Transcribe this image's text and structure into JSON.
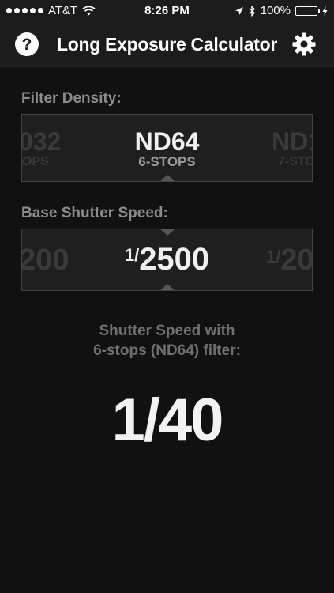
{
  "status_bar": {
    "carrier": "AT&T",
    "time": "8:26 PM",
    "battery": "100%"
  },
  "header": {
    "title": "Long Exposure Calculator",
    "help_icon": "question-circle-icon",
    "settings_icon": "gear-icon"
  },
  "filter_density": {
    "label": "Filter Density:",
    "prev_value": "032",
    "prev_stops": "OPS",
    "selected_value": "ND64",
    "selected_stops": "6-STOPS",
    "next_value": "ND1",
    "next_stops": "7-STO"
  },
  "base_shutter": {
    "label": "Base Shutter Speed:",
    "prev_value": "200",
    "selected_prefix": "1/",
    "selected_value": "2500",
    "next_prefix": "1/",
    "next_value": "20"
  },
  "result": {
    "caption_line1": "Shutter Speed with",
    "caption_line2": "6-stops (ND64) filter:",
    "value": "1/40"
  },
  "colors": {
    "background": "#111111",
    "bar": "#1c1c1c",
    "battery_fill": "#37d146"
  }
}
